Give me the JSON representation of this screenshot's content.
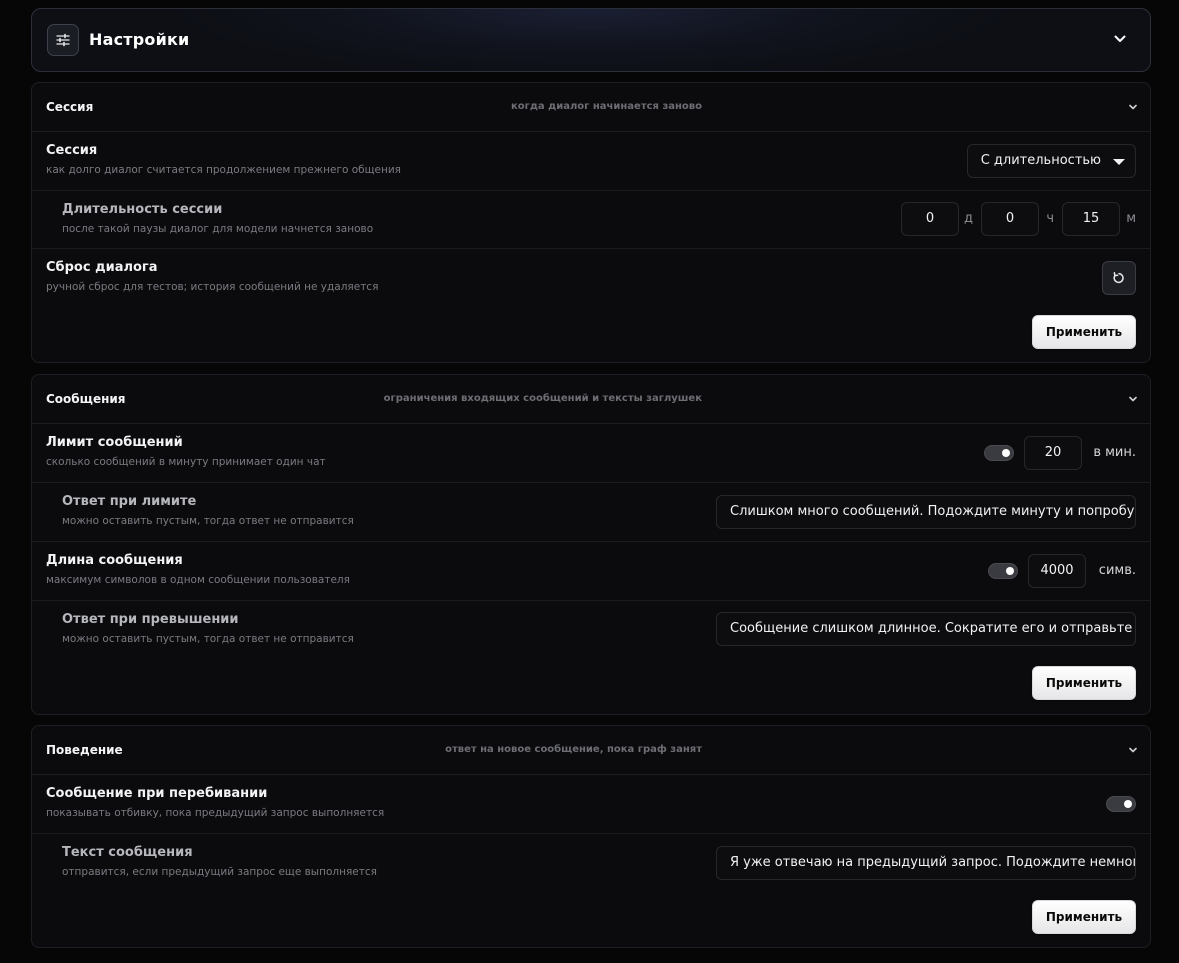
{
  "header": {
    "title": "Настройки",
    "icon": "sliders-icon"
  },
  "session_card": {
    "title": "Сессия",
    "desc": "когда диалог начинается заново",
    "session": {
      "label": "Сессия",
      "sub": "как долго диалог считается продолжением прежнего общения",
      "select_value": "С длительностью"
    },
    "duration": {
      "label": "Длительность сессии",
      "sub": "после такой паузы диалог для модели начнется заново",
      "days": "0",
      "days_unit": "д",
      "hours": "0",
      "hours_unit": "ч",
      "minutes": "15",
      "minutes_unit": "м"
    },
    "reset": {
      "label": "Сброс диалога",
      "sub": "ручной сброс для тестов; история сообщений не удаляется",
      "icon": "reset-icon"
    },
    "apply_label": "Применить"
  },
  "messages_card": {
    "title": "Сообщения",
    "desc": "ограничения входящих сообщений и тексты заглушек",
    "limit": {
      "label": "Лимит сообщений",
      "sub": "сколько сообщений в минуту принимает один чат",
      "enabled": true,
      "value": "20",
      "unit": "в мин."
    },
    "limit_reply": {
      "label": "Ответ при лимите",
      "sub": "можно оставить пустым, тогда ответ не отправится",
      "value": "Слишком много сообщений. Подождите минуту и попробуйте снова."
    },
    "length": {
      "label": "Длина сообщения",
      "sub": "максимум символов в одном сообщении пользователя",
      "enabled": true,
      "value": "4000",
      "unit": "симв."
    },
    "length_reply": {
      "label": "Ответ при превышении",
      "sub": "можно оставить пустым, тогда ответ не отправится",
      "value": "Сообщение слишком длинное. Сократите его и отправьте снова."
    },
    "apply_label": "Применить"
  },
  "behavior_card": {
    "title": "Поведение",
    "desc": "ответ на новое сообщение, пока граф занят",
    "interrupt": {
      "label": "Сообщение при перебивании",
      "sub": "показывать отбивку, пока предыдущий запрос выполняется",
      "enabled": true
    },
    "interrupt_text": {
      "label": "Текст сообщения",
      "sub": "отправится, если предыдущий запрос еще выполняется",
      "value": "Я уже отвечаю на предыдущий запрос. Подождите немного."
    },
    "apply_label": "Применить"
  }
}
